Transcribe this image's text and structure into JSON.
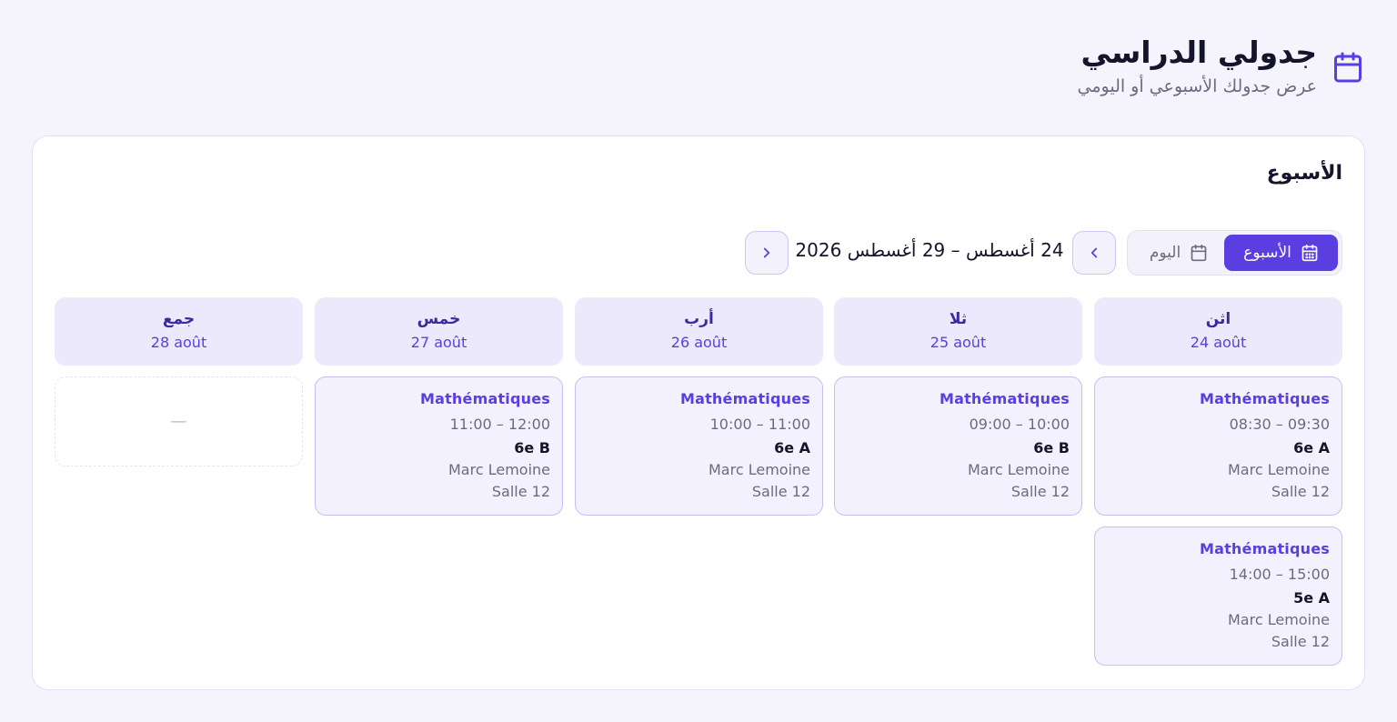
{
  "header": {
    "title": "جدولي الدراسي",
    "subtitle": "عرض جدولك الأسبوعي أو اليومي",
    "icon": "calendar-icon"
  },
  "card": {
    "title": "الأسبوع"
  },
  "toolbar": {
    "week_label": "الأسبوع",
    "day_label": "اليوم",
    "active_view": "week",
    "range": "24 أغسطس – 29 أغسطس 2026",
    "next_icon": "chevron-left-icon",
    "prev_icon": "chevron-right-icon"
  },
  "days": [
    {
      "name": "اثن",
      "date": "24 août"
    },
    {
      "name": "ثلا",
      "date": "25 août"
    },
    {
      "name": "أرب",
      "date": "26 août"
    },
    {
      "name": "خمس",
      "date": "27 août"
    },
    {
      "name": "جمع",
      "date": "28 août"
    }
  ],
  "events": [
    {
      "subject": "Mathématiques",
      "time": "08:30 – 09:30",
      "class": "6e A",
      "teacher": "Marc Lemoine",
      "room": "Salle 12"
    },
    {
      "subject": "Mathématiques",
      "time": "14:00 – 15:00",
      "class": "5e A",
      "teacher": "Marc Lemoine",
      "room": "Salle 12"
    },
    {
      "subject": "Mathématiques",
      "time": "09:00 – 10:00",
      "class": "6e B",
      "teacher": "Marc Lemoine",
      "room": "Salle 12"
    },
    {
      "subject": "Mathématiques",
      "time": "10:00 – 11:00",
      "class": "6e A",
      "teacher": "Marc Lemoine",
      "room": "Salle 12"
    },
    {
      "subject": "Mathématiques",
      "time": "11:00 – 12:00",
      "class": "6e B",
      "teacher": "Marc Lemoine",
      "room": "Salle 12"
    }
  ],
  "empty_slot": "—",
  "colors": {
    "accent": "#5a3ee0",
    "background": "#f5f4fd",
    "header_bg": "#ece9fc",
    "event_bg": "#f3f1fd"
  }
}
